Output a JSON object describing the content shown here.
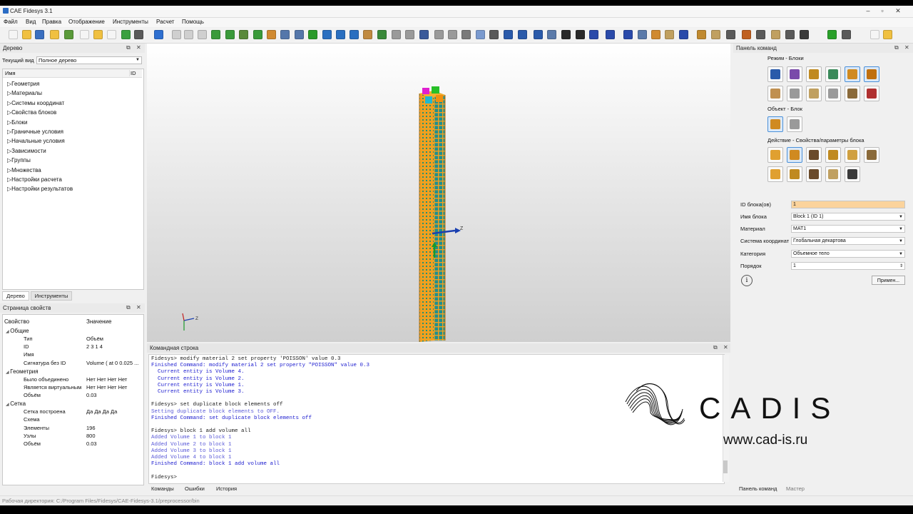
{
  "window": {
    "title": "CAE Fidesys 3.1"
  },
  "menu": [
    "Файл",
    "Вид",
    "Правка",
    "Отображение",
    "Инструменты",
    "Расчет",
    "Помощь"
  ],
  "tree_panel": {
    "title": "Дерево",
    "current_view_label": "Текущий вид",
    "current_view_value": "Полное дерево",
    "col_name": "Имя",
    "col_id": "ID",
    "items": [
      "Геометрия",
      "Материалы",
      "Системы координат",
      "Свойства блоков",
      "Блоки",
      "Граничные условия",
      "Начальные условия",
      "Зависимости",
      "Группы",
      "Множества",
      "Настройки расчета",
      "Настройки результатов"
    ],
    "tabs": [
      "Дерево",
      "Инструменты"
    ]
  },
  "props_panel": {
    "title": "Страница свойств",
    "col_prop": "Свойство",
    "col_val": "Значение",
    "groups": {
      "general": "Общие",
      "geometry": "Геометрия",
      "mesh": "Сетка"
    },
    "rows": [
      {
        "k": "Тип",
        "v": "Объём"
      },
      {
        "k": "ID",
        "v": "2 3 1 4"
      },
      {
        "k": "Имя",
        "v": ""
      },
      {
        "k": "Сигнатура без ID",
        "v": "Volume ( at 0 0.025 ..."
      },
      {
        "k": "Было объединено",
        "v": "Нет Нет Нет Нет"
      },
      {
        "k": "Является виртуальным",
        "v": "Нет Нет Нет Нет"
      },
      {
        "k": "Объём",
        "v": "0.03"
      },
      {
        "k": "Сетка построена",
        "v": "Да Да Да Да"
      },
      {
        "k": "Схема",
        "v": ""
      },
      {
        "k": "Элементы",
        "v": "196"
      },
      {
        "k": "Узлы",
        "v": "800"
      },
      {
        "k": "Объём",
        "v": "0.03"
      }
    ]
  },
  "viewport": {
    "axis_z": "Z",
    "axis_small_z": "Z"
  },
  "command_panel": {
    "title": "Командная строка",
    "lines": [
      {
        "t": "Fidesys> modify material 2 set property 'POISSON' value 0.3",
        "c": "cmd"
      },
      {
        "t": "Finished Command: modify material 2 set property \"POISSON\" value 0.3",
        "c": "out"
      },
      {
        "t": "  Current entity is Volume 4.",
        "c": "out"
      },
      {
        "t": "  Current entity is Volume 2.",
        "c": "out"
      },
      {
        "t": "  Current entity is Volume 1.",
        "c": "out"
      },
      {
        "t": "  Current entity is Volume 3.",
        "c": "out"
      },
      {
        "t": "",
        "c": "cmd"
      },
      {
        "t": "Fidesys> set duplicate block elements off",
        "c": "cmd"
      },
      {
        "t": "Setting duplicate block elements to OFF.",
        "c": "res"
      },
      {
        "t": "Finished Command: set duplicate block elements off",
        "c": "out"
      },
      {
        "t": "",
        "c": "cmd"
      },
      {
        "t": "Fidesys> block 1 add volume all",
        "c": "cmd"
      },
      {
        "t": "Added Volume 1 to block 1",
        "c": "res"
      },
      {
        "t": "Added Volume 2 to block 1",
        "c": "res"
      },
      {
        "t": "Added Volume 3 to block 1",
        "c": "res"
      },
      {
        "t": "Added Volume 4 to block 1",
        "c": "res"
      },
      {
        "t": "Finished Command: block 1 add volume all",
        "c": "out"
      },
      {
        "t": "",
        "c": "cmd"
      },
      {
        "t": "Fidesys>",
        "c": "cmd"
      }
    ],
    "tabs": [
      "Команды",
      "Ошибки",
      "История"
    ]
  },
  "right_panel": {
    "title": "Панель команд",
    "mode_label": "Режим - Блоки",
    "object_label": "Объект - Блок",
    "action_label": "Действие - Свойства/параметры блока",
    "fields": [
      {
        "label": "ID блока(ов)",
        "value": "1",
        "type": "text"
      },
      {
        "label": "Имя блока",
        "value": "Block 1 (ID 1)",
        "type": "select"
      },
      {
        "label": "Материал",
        "value": "MAT1",
        "type": "select"
      },
      {
        "label": "Система координат",
        "value": "Глобальная декартова",
        "type": "select"
      },
      {
        "label": "Категория",
        "value": "Объемное тело",
        "type": "select"
      },
      {
        "label": "Порядок",
        "value": "1",
        "type": "spin"
      }
    ],
    "apply_label": "Примен...",
    "tabs": [
      "Панель команд",
      "Мастер"
    ]
  },
  "status_bar": {
    "text": "Рабочая директория: C:/Program Files/Fidesys/CAE-Fidesys-3.1/preprocessor/bin"
  },
  "watermark": {
    "brand": "CADIS",
    "url": "www.cad-is.ru"
  },
  "colors": {
    "accent": "#4a90d9",
    "mesh_orange": "#f0a020",
    "mesh_teal": "#1f8f8f",
    "id_field_bg": "#fbd39c"
  }
}
